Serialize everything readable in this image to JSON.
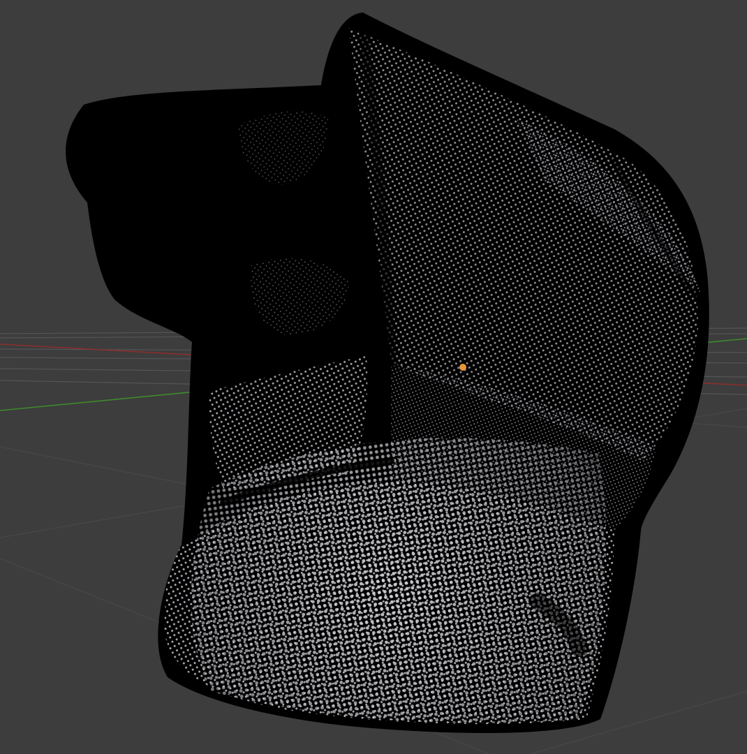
{
  "viewport": {
    "background_color": "#3d3d3d",
    "grid_color": "#4a4a4a",
    "grid_color_light": "#555555",
    "x_axis_color": "#8b2e2e",
    "y_axis_color": "#3f8a2c",
    "mesh_fill_color": "#000000",
    "vertex_color": "#b9b9c0",
    "vertex_highlight_color": "#e2e2e8",
    "origin_color": "#e8963a",
    "mesh_display": "vertices",
    "origin_marker": "object-origin-icon"
  }
}
